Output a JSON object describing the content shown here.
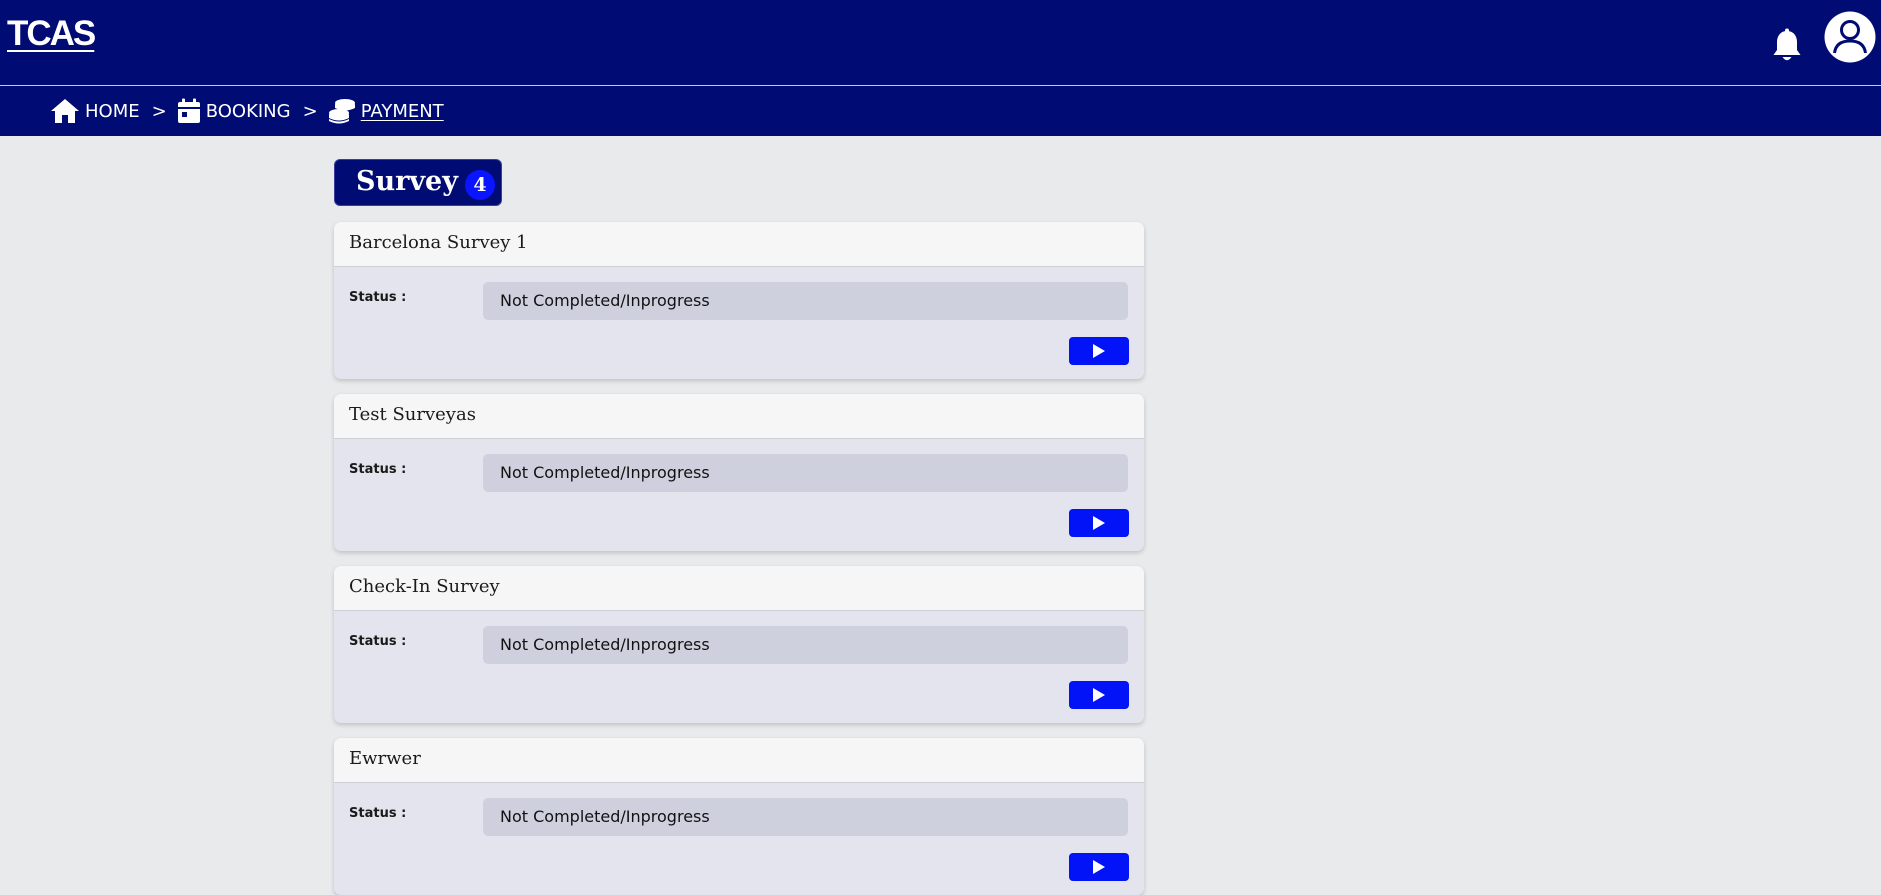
{
  "app": {
    "logo": "TCAS"
  },
  "header": {
    "bell_icon": "bell-icon",
    "avatar_icon": "user-avatar-icon"
  },
  "breadcrumb": {
    "items": [
      {
        "label": "HOME",
        "icon": "home-icon"
      },
      {
        "label": "BOOKING",
        "icon": "calendar-icon"
      },
      {
        "label": "PAYMENT",
        "icon": "coins-icon"
      }
    ],
    "separator": ">"
  },
  "survey": {
    "title": "Survey",
    "count": "4",
    "status_label": "Status :",
    "items": [
      {
        "title": "Barcelona Survey 1",
        "status": "Not Completed/Inprogress"
      },
      {
        "title": "Test Surveyas",
        "status": "Not Completed/Inprogress"
      },
      {
        "title": "Check-In Survey",
        "status": "Not Completed/Inprogress"
      },
      {
        "title": "Ewrwer",
        "status": "Not Completed/Inprogress"
      }
    ]
  },
  "colors": {
    "header_bg": "#000c73",
    "page_bg": "#e9eaec",
    "accent": "#0313f7",
    "status_bg": "#cfd0dd"
  }
}
